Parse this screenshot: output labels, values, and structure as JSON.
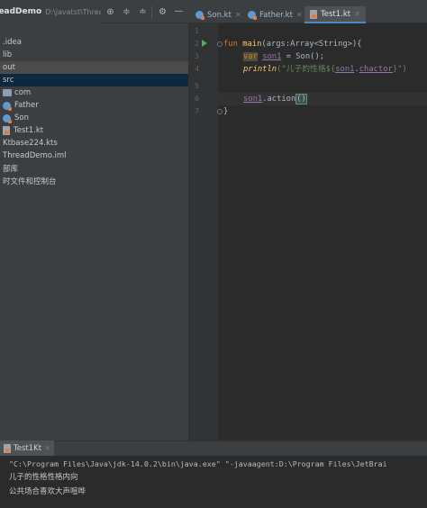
{
  "toolbar": {
    "project_name": "readDemo",
    "project_path": "D:\\javatst\\ThreadDemo",
    "icons": [
      "target-icon",
      "expand-icon",
      "collapse-icon",
      "gear-icon",
      "minimize-icon"
    ]
  },
  "tabs": [
    {
      "label": "Son.kt",
      "icon": "kotlin-class-icon",
      "active": false
    },
    {
      "label": "Father.kt",
      "icon": "kotlin-class-icon",
      "active": false
    },
    {
      "label": "Test1.kt",
      "icon": "kotlin-file-icon",
      "active": true
    }
  ],
  "tree": [
    {
      "label": ".idea",
      "icon": "none"
    },
    {
      "label": "lib",
      "icon": "none"
    },
    {
      "label": "out",
      "icon": "none",
      "selected": "gray"
    },
    {
      "label": "src",
      "icon": "none",
      "selected": "blue"
    },
    {
      "label": "com",
      "icon": "folder-icon"
    },
    {
      "label": "Father",
      "icon": "kotlin-class-icon"
    },
    {
      "label": "Son",
      "icon": "kotlin-class-icon"
    },
    {
      "label": "Test1.kt",
      "icon": "kotlin-file-icon"
    },
    {
      "label": "Ktbase224.kts",
      "icon": "none"
    },
    {
      "label": "ThreadDemo.iml",
      "icon": "none"
    },
    {
      "label": "部库",
      "icon": "none"
    },
    {
      "label": "时文件和控制台",
      "icon": "none"
    }
  ],
  "editor": {
    "line_numbers": [
      "1",
      "2",
      "3",
      "4",
      "5",
      "6",
      "7"
    ],
    "line2": {
      "kw": "fun",
      "fn": "main",
      "rest": "(args:Array<String>){"
    },
    "line3": {
      "kw": "var",
      "var": "son1",
      "rest": " = Son();"
    },
    "line4": {
      "fn": "println",
      "open": "(\"儿子的性格${",
      "var": "son1",
      "dot": ".",
      "prop": "chactor",
      "close": "}\")"
    },
    "line6": {
      "var": "son1",
      "rest": ".action",
      "paren": "()"
    },
    "line7": {
      "brace": "}"
    }
  },
  "run": {
    "tab_label": "Test1Kt",
    "command": "\"C:\\Program Files\\Java\\jdk-14.0.2\\bin\\java.exe\" \"-javaagent:D:\\Program Files\\JetBrai",
    "output": [
      "儿子的性格性格内向",
      "公共场合喜欢大声喧哗"
    ]
  }
}
